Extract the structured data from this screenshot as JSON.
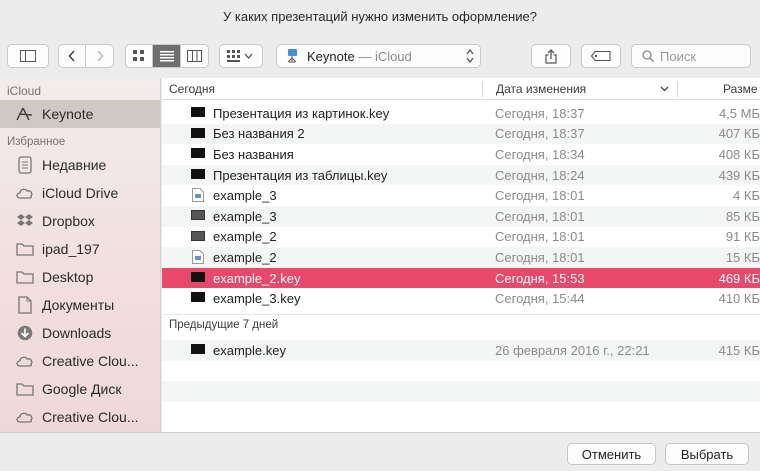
{
  "title": "У каких презентаций нужно изменить оформление?",
  "location": {
    "app": "Keynote",
    "separator": " — ",
    "service": "iCloud"
  },
  "search": {
    "placeholder": "Поиск"
  },
  "sidebar": {
    "sections": [
      {
        "header": "iCloud",
        "items": [
          {
            "label": "Keynote",
            "icon": "keynote-icon",
            "selected": true
          }
        ]
      },
      {
        "header": "Избранное",
        "items": [
          {
            "label": "Недавние",
            "icon": "recents-icon"
          },
          {
            "label": "iCloud Drive",
            "icon": "cloud-icon"
          },
          {
            "label": "Dropbox",
            "icon": "dropbox-icon"
          },
          {
            "label": "ipad_197",
            "icon": "folder-icon"
          },
          {
            "label": "Desktop",
            "icon": "desktop-icon"
          },
          {
            "label": "Документы",
            "icon": "document-icon"
          },
          {
            "label": "Downloads",
            "icon": "downloads-icon"
          },
          {
            "label": "Creative Clou...",
            "icon": "creative-cloud-icon"
          },
          {
            "label": "Google Диск",
            "icon": "folder-icon"
          },
          {
            "label": "Creative Clou...",
            "icon": "creative-cloud-icon"
          }
        ]
      }
    ]
  },
  "columns": {
    "name": "Сегодня",
    "date": "Дата изменения",
    "size": "Разме"
  },
  "groups": [
    {
      "files": [
        {
          "name": "Презентация из картинок.key",
          "date": "Сегодня, 18:37",
          "size": "4,5 МБ",
          "icon": "keynote-file-icon"
        },
        {
          "name": "Без названия 2",
          "date": "Сегодня, 18:37",
          "size": "407 КБ",
          "icon": "keynote-file-icon"
        },
        {
          "name": "Без названия",
          "date": "Сегодня, 18:34",
          "size": "408 КБ",
          "icon": "keynote-file-icon"
        },
        {
          "name": "Презентация из таблицы.key",
          "date": "Сегодня, 18:24",
          "size": "439 КБ",
          "icon": "keynote-file-icon"
        },
        {
          "name": "example_3",
          "date": "Сегодня, 18:01",
          "size": "4 КБ",
          "icon": "generic-file-icon"
        },
        {
          "name": "example_3",
          "date": "Сегодня, 18:01",
          "size": "85 КБ",
          "icon": "keynote-file-icon"
        },
        {
          "name": "example_2",
          "date": "Сегодня, 18:01",
          "size": "91 КБ",
          "icon": "keynote-file-icon"
        },
        {
          "name": "example_2",
          "date": "Сегодня, 18:01",
          "size": "15 КБ",
          "icon": "generic-file-icon"
        },
        {
          "name": "example_2.key",
          "date": "Сегодня, 15:53",
          "size": "469 КБ",
          "icon": "keynote-file-icon",
          "selected": true
        },
        {
          "name": "example_3.key",
          "date": "Сегодня, 15:44",
          "size": "410 КБ",
          "icon": "keynote-file-icon"
        }
      ]
    },
    {
      "header": "Предыдущие 7 дней",
      "files": [
        {
          "name": "example.key",
          "date": "26 февраля 2016 г., 22:21",
          "size": "415 КБ",
          "icon": "keynote-file-icon"
        }
      ]
    }
  ],
  "buttons": {
    "cancel": "Отменить",
    "select": "Выбрать"
  },
  "colors": {
    "selection": "#e8486a",
    "sidebar_selected": "#d0c9c3"
  }
}
